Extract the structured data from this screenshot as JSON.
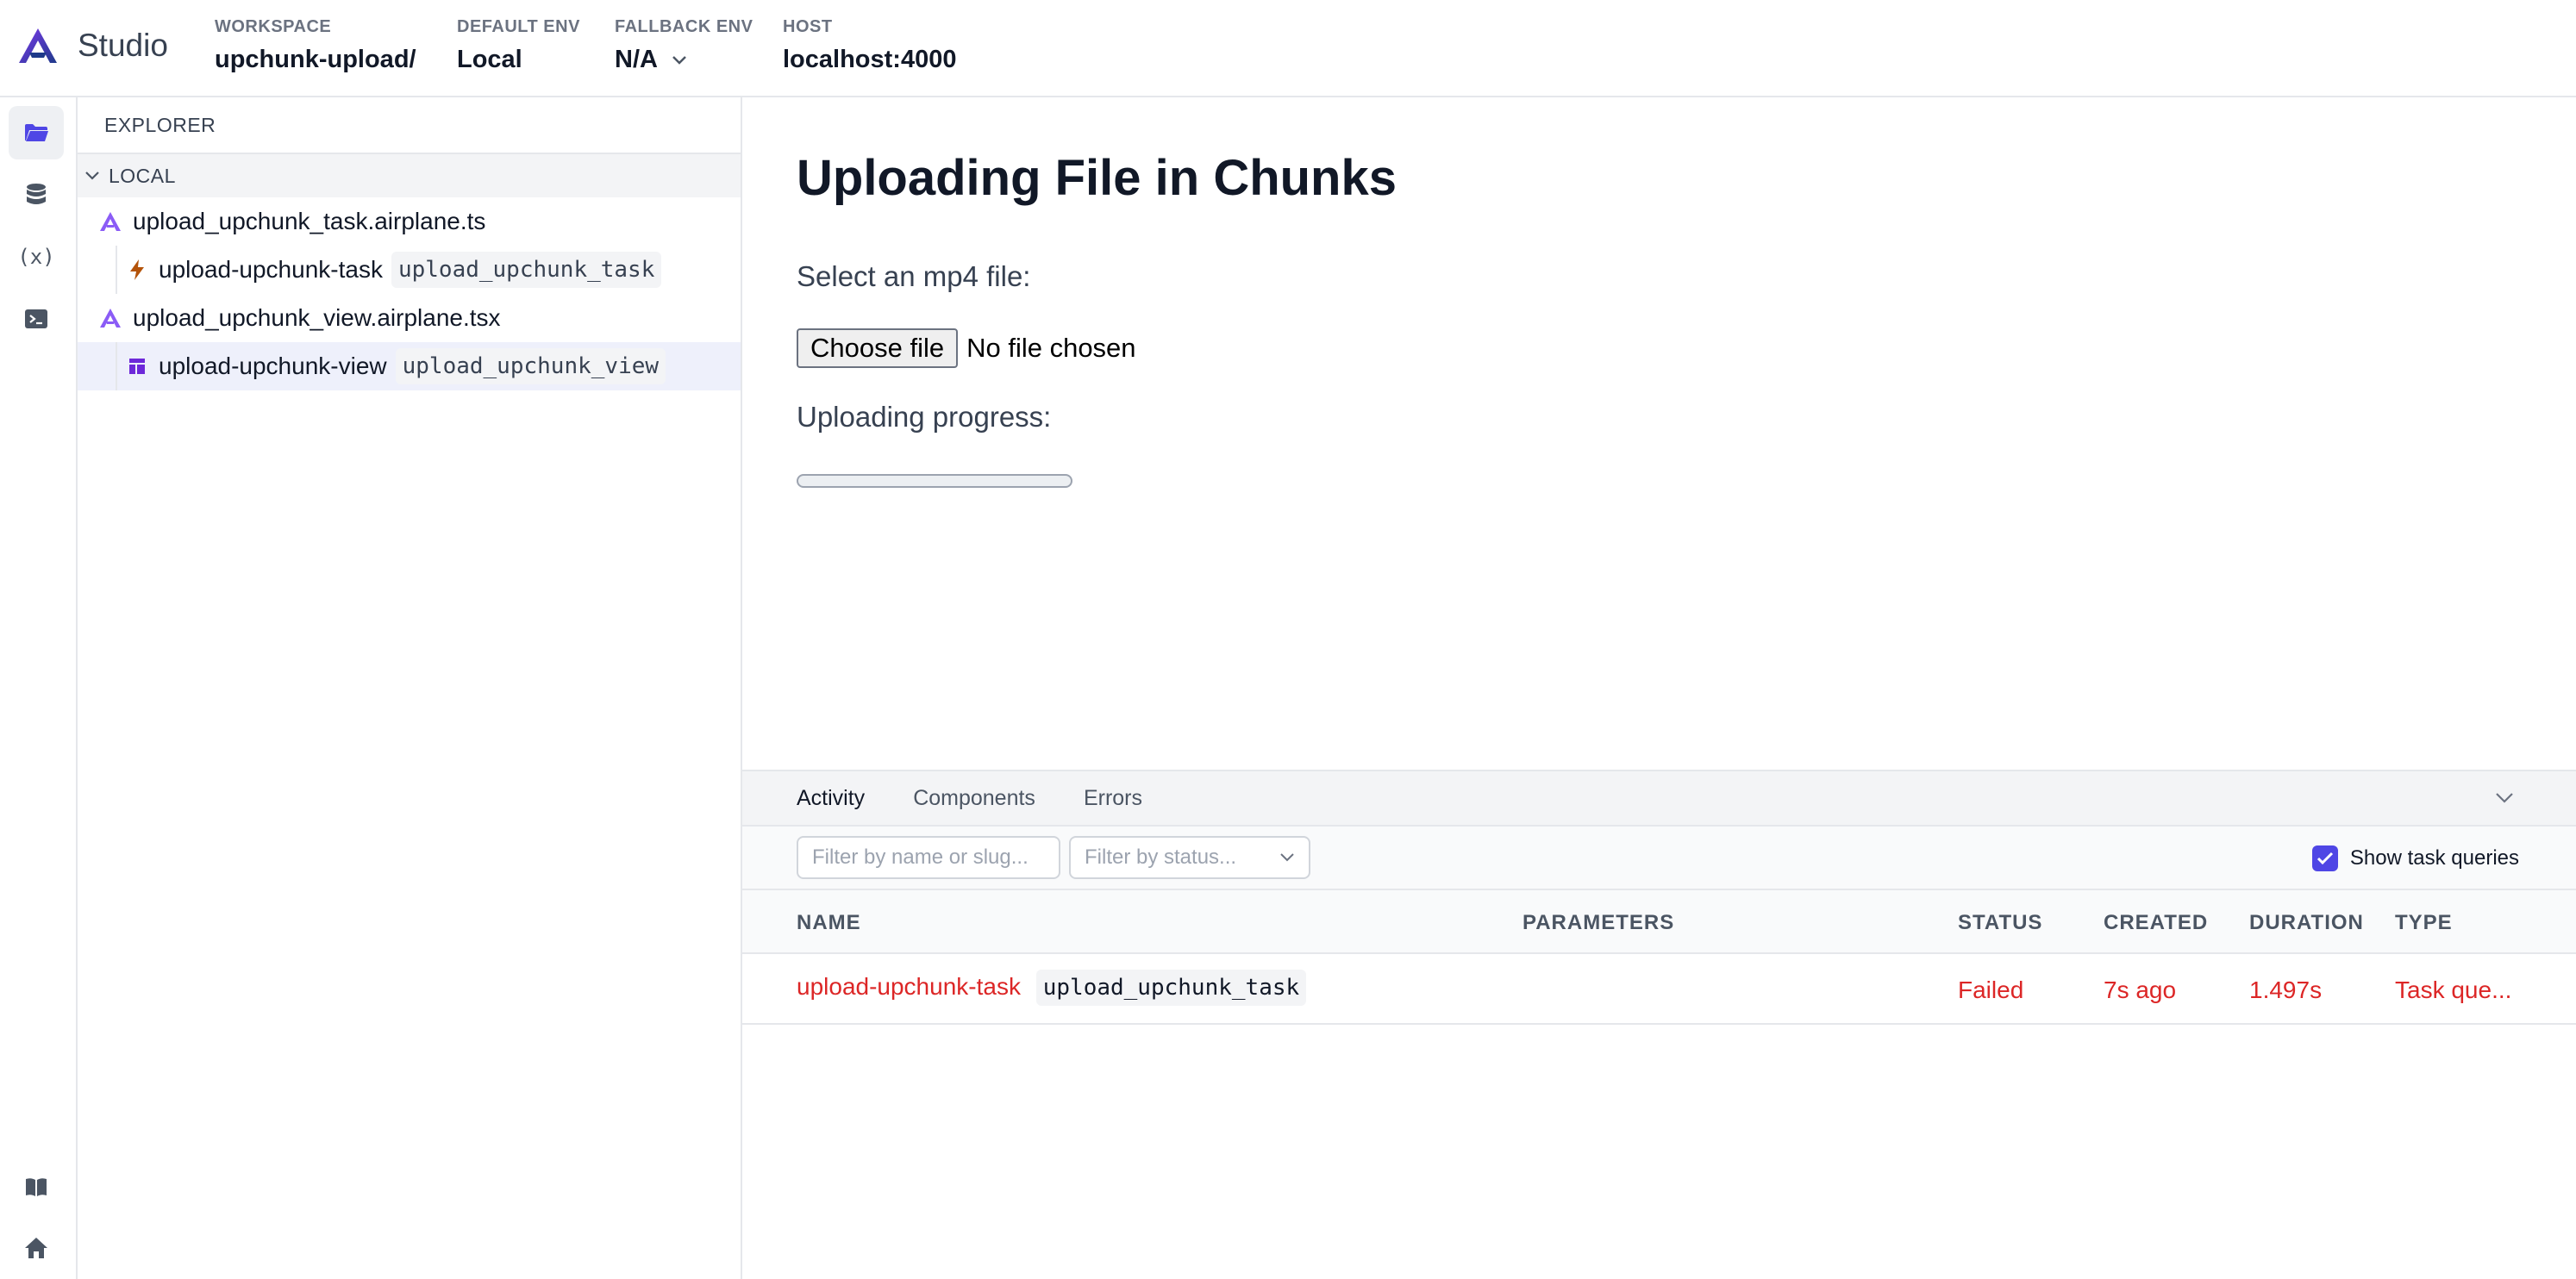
{
  "header": {
    "brand": "Studio",
    "workspace_label": "WORKSPACE",
    "workspace_value": "upchunk-upload/",
    "default_env_label": "DEFAULT ENV",
    "default_env_value": "Local",
    "fallback_env_label": "FALLBACK ENV",
    "fallback_env_value": "N/A",
    "host_label": "HOST",
    "host_value": "localhost:4000"
  },
  "rail": {
    "items": [
      "folder-icon",
      "database-icon",
      "variable-icon",
      "terminal-icon"
    ],
    "variable_text": "(x)",
    "bottom_items": [
      "book-icon",
      "home-icon"
    ]
  },
  "explorer": {
    "title": "EXPLORER",
    "section": "LOCAL",
    "files": [
      {
        "name": "upload_upchunk_task.airplane.ts",
        "child_name": "upload-upchunk-task",
        "child_slug": "upload_upchunk_task"
      },
      {
        "name": "upload_upchunk_view.airplane.tsx",
        "child_name": "upload-upchunk-view",
        "child_slug": "upload_upchunk_view"
      }
    ]
  },
  "view": {
    "title": "Uploading File in Chunks",
    "select_label": "Select an mp4 file:",
    "choose_button": "Choose file",
    "no_file": "No file chosen",
    "progress_label": "Uploading progress:",
    "progress_value": 0
  },
  "panel": {
    "tabs": [
      "Activity",
      "Components",
      "Errors"
    ],
    "filter_name_placeholder": "Filter by name or slug...",
    "filter_status_placeholder": "Filter by status...",
    "show_task_queries": "Show task queries",
    "columns": [
      "NAME",
      "PARAMETERS",
      "STATUS",
      "CREATED",
      "DURATION",
      "TYPE"
    ],
    "rows": [
      {
        "name": "upload-upchunk-task",
        "slug": "upload_upchunk_task",
        "parameters": "",
        "status": "Failed",
        "created": "7s ago",
        "duration": "1.497s",
        "type": "Task que..."
      }
    ]
  },
  "colors": {
    "accent": "#4f46e5",
    "error": "#dc2626",
    "task_icon": "#b45309",
    "view_icon": "#6d28d9"
  }
}
